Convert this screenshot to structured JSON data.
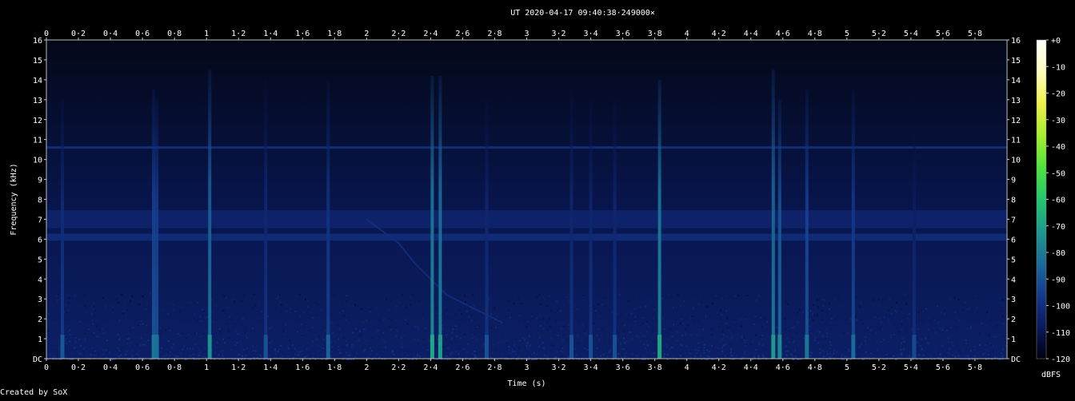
{
  "chart_data": {
    "type": "heatmap",
    "title": "UT 2020-04-17 09:40:38·249000×",
    "xlabel": "Time (s)",
    "ylabel": "Frequency (kHz)",
    "xlim": [
      0,
      6
    ],
    "ylim": [
      0,
      16
    ],
    "x_ticks": [
      "0",
      "0·2",
      "0·4",
      "0·6",
      "0·8",
      "1",
      "1·2",
      "1·4",
      "1·6",
      "1·8",
      "2",
      "2·2",
      "2·4",
      "2·6",
      "2·8",
      "3",
      "3·2",
      "3·4",
      "3·6",
      "3·8",
      "4",
      "4·2",
      "4·4",
      "4·6",
      "4·8",
      "5",
      "5·2",
      "5·4",
      "5·6",
      "5·8"
    ],
    "y_ticks": [
      "DC",
      "1",
      "2",
      "3",
      "4",
      "5",
      "6",
      "7",
      "8",
      "9",
      "10",
      "11",
      "12",
      "13",
      "14",
      "15",
      "16"
    ],
    "colorbar": {
      "label": "dBFS",
      "range": [
        -120,
        0
      ],
      "ticks": [
        "+0",
        "-10",
        "-20",
        "-30",
        "-40",
        "-50",
        "-60",
        "-70",
        "-80",
        "-90",
        "-100",
        "-110",
        "-120"
      ],
      "colors": [
        "#000010",
        "#0a1a5c",
        "#15398c",
        "#1a6b9a",
        "#1c9a8e",
        "#24c66e",
        "#4ee33d",
        "#a6ef2e",
        "#f0f04a",
        "#ffffc0",
        "#ffffff"
      ]
    },
    "background_level_dbfs": -110,
    "noise_band_khz": [
      0,
      1.5
    ],
    "horizontal_lines": [
      {
        "freq_khz": 10.6,
        "level_dbfs": -98
      },
      {
        "freq_khz": 6.1,
        "width_khz": 0.35,
        "level_dbfs": -100
      },
      {
        "freq_khz": 7.0,
        "width_khz": 0.9,
        "level_dbfs": -104
      }
    ],
    "impulses": [
      {
        "time_s": 0.1,
        "fmax_khz": 13,
        "level_dbfs": -102
      },
      {
        "time_s": 0.67,
        "fmax_khz": 13.5,
        "level_dbfs": -95
      },
      {
        "time_s": 0.69,
        "fmax_khz": 13,
        "level_dbfs": -96
      },
      {
        "time_s": 1.02,
        "fmax_khz": 14.5,
        "level_dbfs": -88
      },
      {
        "time_s": 1.37,
        "fmax_khz": 14,
        "level_dbfs": -104
      },
      {
        "time_s": 1.76,
        "fmax_khz": 14,
        "level_dbfs": -100
      },
      {
        "time_s": 2.41,
        "fmax_khz": 14.2,
        "level_dbfs": -82
      },
      {
        "time_s": 2.46,
        "fmax_khz": 14.2,
        "level_dbfs": -84
      },
      {
        "time_s": 2.75,
        "fmax_khz": 13,
        "level_dbfs": -104
      },
      {
        "time_s": 3.28,
        "fmax_khz": 13.5,
        "level_dbfs": -104
      },
      {
        "time_s": 3.4,
        "fmax_khz": 13,
        "level_dbfs": -104
      },
      {
        "time_s": 3.55,
        "fmax_khz": 13,
        "level_dbfs": -104
      },
      {
        "time_s": 3.83,
        "fmax_khz": 14,
        "level_dbfs": -82
      },
      {
        "time_s": 4.54,
        "fmax_khz": 14.5,
        "level_dbfs": -86
      },
      {
        "time_s": 4.58,
        "fmax_khz": 13,
        "level_dbfs": -90
      },
      {
        "time_s": 4.75,
        "fmax_khz": 13.5,
        "level_dbfs": -95
      },
      {
        "time_s": 5.04,
        "fmax_khz": 13.5,
        "level_dbfs": -98
      },
      {
        "time_s": 5.42,
        "fmax_khz": 12,
        "level_dbfs": -106
      }
    ],
    "sweeps": [
      {
        "points": [
          [
            2.0,
            7.0
          ],
          [
            2.2,
            5.8
          ],
          [
            2.3,
            4.8
          ],
          [
            2.4,
            4.0
          ],
          [
            2.5,
            3.2
          ],
          [
            2.65,
            2.6
          ],
          [
            2.85,
            1.8
          ]
        ],
        "level_dbfs": -100
      }
    ]
  },
  "footer": {
    "credit": "Created by SoX"
  }
}
